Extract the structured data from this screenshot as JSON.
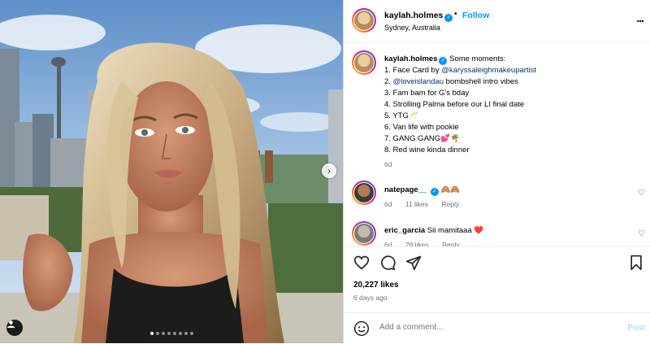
{
  "header": {
    "username": "kaylah.holmes",
    "separator": "•",
    "follow_label": "Follow",
    "location": "Sydney, Australia",
    "more_label": "..."
  },
  "caption": {
    "username": "kaylah.holmes",
    "lines": [
      {
        "text": "Some moments:"
      },
      {
        "prefix": "1. Face Card by ",
        "link": "@karyssaleighmakeupartist",
        "suffix": ""
      },
      {
        "prefix": "2. ",
        "link": "@loveislandau",
        "suffix": " bombshell intro vibes"
      },
      {
        "text": "3. Fam bam for G's bday"
      },
      {
        "text": "4. Strolling Palma before our LI final date"
      },
      {
        "text": "5. YTG🥂"
      },
      {
        "text": "6. Van life with pookie"
      },
      {
        "text": "7. GANG GANG💕🌴"
      },
      {
        "text": "8. Red wine kinda dinner"
      }
    ],
    "age": "6d"
  },
  "comments": [
    {
      "username": "natepage__",
      "text": "🙈🙈",
      "age": "6d",
      "likes": "11 likes",
      "reply": "Reply"
    },
    {
      "username": "eric_garcia",
      "text": "Sii mamitaaa ❤️",
      "age": "6d",
      "likes": "28 likes",
      "reply": "Reply"
    }
  ],
  "stats": {
    "likes": "20,227 likes",
    "time_ago": "6 days ago"
  },
  "add_comment": {
    "placeholder": "Add a comment...",
    "post_label": "Post"
  },
  "carousel": {
    "slide_count": 8,
    "active_index": 0,
    "next_arrow": "›"
  },
  "icons": {
    "like": "heart-icon",
    "comment": "comment-bubble-icon",
    "share": "paper-plane-icon",
    "save": "bookmark-icon",
    "emoji": "smiley-icon",
    "user_tag": "person-icon"
  },
  "colors": {
    "accent": "#0095f6",
    "link": "#00376b",
    "muted": "#737373",
    "post_disabled": "#b3dbff"
  }
}
